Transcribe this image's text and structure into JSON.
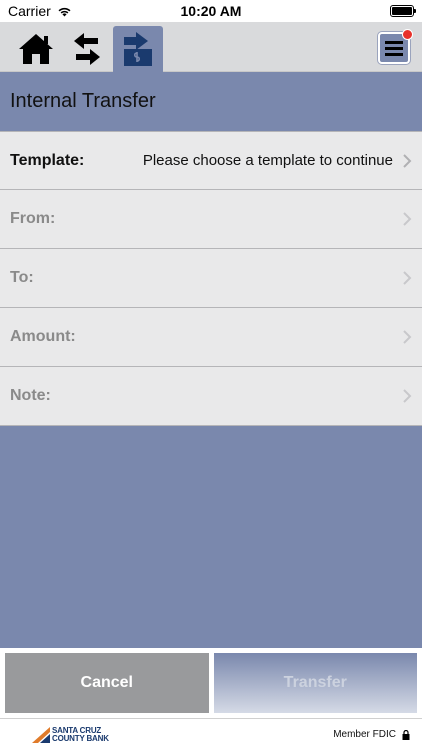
{
  "status_bar": {
    "carrier": "Carrier",
    "time": "10:20 AM"
  },
  "nav": {
    "icons": [
      "home-icon",
      "transfer-arrows-icon",
      "internal-transfer-icon",
      "hamburger-menu-icon"
    ],
    "colors": {
      "active_tab": "#7a88ad",
      "badge": "#e8312b"
    }
  },
  "page": {
    "title": "Internal Transfer"
  },
  "form": {
    "template": {
      "label": "Template:",
      "value": "Please choose a template to continue"
    },
    "from": {
      "label": "From:"
    },
    "to": {
      "label": "To:"
    },
    "amount": {
      "label": "Amount:"
    },
    "note": {
      "label": "Note:"
    }
  },
  "buttons": {
    "cancel": "Cancel",
    "transfer": "Transfer"
  },
  "footer": {
    "logo_line1": "SANTA CRUZ",
    "logo_line2": "COUNTY BANK",
    "fdic": "Member FDIC"
  }
}
